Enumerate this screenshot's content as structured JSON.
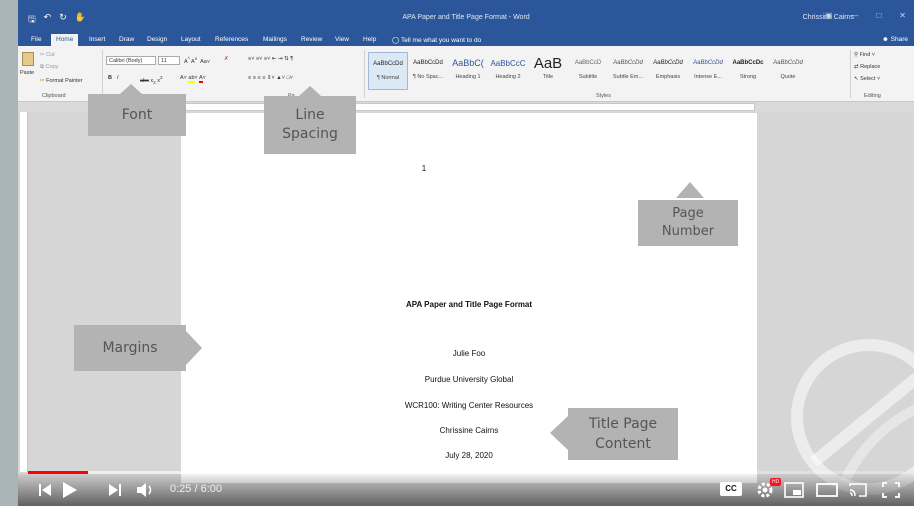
{
  "window": {
    "title": "APA Paper and Title Page Format - Word",
    "user": "Chrissine Cairns"
  },
  "tabs": [
    "File",
    "Home",
    "Insert",
    "Draw",
    "Design",
    "Layout",
    "References",
    "Mailings",
    "Review",
    "View",
    "Help"
  ],
  "tell_me": "Tell me what you want to do",
  "share": "Share",
  "ribbon": {
    "clipboard": {
      "cut": "Cut",
      "copy": "Copy",
      "paste": "Paste",
      "format_painter": "Format Painter",
      "label": "Clipboard"
    },
    "font": {
      "name": "Calibri (Body)",
      "size": "11",
      "label": "Font"
    },
    "paragraph": {
      "label": "Pa"
    },
    "styles": {
      "label": "Styles",
      "items": [
        {
          "sample": "AaBbCcDd",
          "name": "¶ Normal"
        },
        {
          "sample": "AaBbCcDd",
          "name": "¶ No Spac..."
        },
        {
          "sample": "AaBbC(",
          "name": "Heading 1"
        },
        {
          "sample": "AaBbCcC",
          "name": "Heading 2"
        },
        {
          "sample": "AaB",
          "name": "Title"
        },
        {
          "sample": "AaBbCcD",
          "name": "Subtitle"
        },
        {
          "sample": "AaBbCcDd",
          "name": "Subtle Em..."
        },
        {
          "sample": "AaBbCcDd",
          "name": "Emphasis"
        },
        {
          "sample": "AaBbCcDd",
          "name": "Intense E..."
        },
        {
          "sample": "AaBbCcDc",
          "name": "Strong"
        },
        {
          "sample": "AaBbCcDd",
          "name": "Quote"
        }
      ]
    },
    "editing": {
      "find": "Find",
      "replace": "Replace",
      "select": "Select",
      "label": "Editing"
    }
  },
  "document": {
    "page_number": "1",
    "title": "APA Paper and Title Page Format",
    "author": "Julie Foo",
    "institution": "Purdue University Global",
    "course": "WCR100: Writing Center Resources",
    "instructor": "Chrissine Cairns",
    "date": "July 28, 2020"
  },
  "callouts": {
    "font": "Font",
    "line_spacing_1": "Line",
    "line_spacing_2": "Spacing",
    "page_number_1": "Page",
    "page_number_2": "Number",
    "margins": "Margins",
    "title_page_1": "Title Page",
    "title_page_2": "Content"
  },
  "player": {
    "time": "0:25 / 6:00",
    "cc": "CC",
    "hd": "HD",
    "progress_fraction": 0.069
  }
}
